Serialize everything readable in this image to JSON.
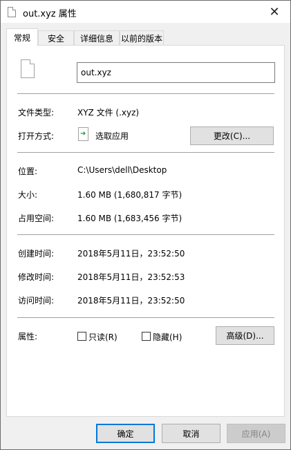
{
  "window": {
    "title": "out.xyz 属性",
    "close_glyph": "✕"
  },
  "tabs": [
    {
      "label": "常规",
      "active": true
    },
    {
      "label": "安全",
      "active": false
    },
    {
      "label": "详细信息",
      "active": false
    },
    {
      "label": "以前的版本",
      "active": false
    }
  ],
  "general": {
    "file_name": "out.xyz",
    "file_type_label": "文件类型:",
    "file_type_value": "XYZ 文件 (.xyz)",
    "open_with_label": "打开方式:",
    "open_with_value": "选取应用",
    "change_button": "更改(C)...",
    "location_label": "位置:",
    "location_value": "C:\\Users\\dell\\Desktop",
    "size_label": "大小:",
    "size_value": "1.60 MB (1,680,817 字节)",
    "size_on_disk_label": "占用空间:",
    "size_on_disk_value": "1.60 MB (1,683,456 字节)",
    "created_label": "创建时间:",
    "created_value": "2018年5月11日，23:52:50",
    "modified_label": "修改时间:",
    "modified_value": "2018年5月11日，23:52:53",
    "accessed_label": "访问时间:",
    "accessed_value": "2018年5月11日，23:52:50",
    "attributes_label": "属性:",
    "readonly_label": "只读(R)",
    "readonly_checked": false,
    "hidden_label": "隐藏(H)",
    "hidden_checked": false,
    "advanced_button": "高级(D)..."
  },
  "footer": {
    "ok": "确定",
    "cancel": "取消",
    "apply": "应用(A)"
  },
  "colors": {
    "default_button_border": "#0078d7",
    "window_bg": "#f0f0f0",
    "panel_bg": "#ffffff"
  }
}
